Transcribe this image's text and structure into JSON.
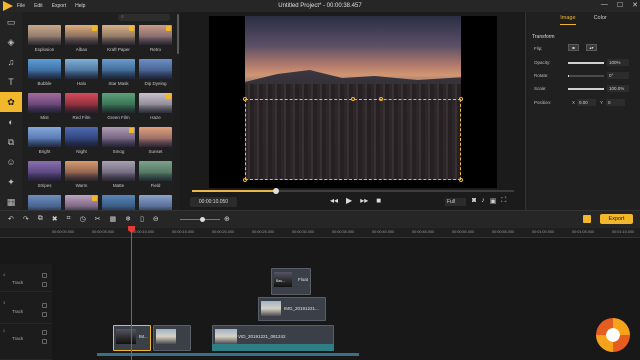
{
  "menubar": {
    "items": [
      "File",
      "Edit",
      "Export",
      "Help"
    ],
    "title": "Untitled Project* - 00:00:38.457",
    "controls": [
      "—",
      "☐",
      "✕"
    ]
  },
  "rail": {
    "icons": [
      "folder-icon",
      "layers-icon",
      "music-icon",
      "text-icon",
      "filter-icon",
      "overlay-icon",
      "transition-icon",
      "sticker-icon",
      "effects-icon",
      "element-icon"
    ],
    "active_index": 4
  },
  "filters": {
    "search_placeholder": "",
    "items": [
      {
        "label": "Explosion",
        "badge": false,
        "colors": [
          "#c8a98a",
          "#6b5b5a"
        ]
      },
      {
        "label": "Albao",
        "badge": true,
        "colors": [
          "#e0b07a",
          "#4a3e4a"
        ]
      },
      {
        "label": "Kraft Paper",
        "badge": true,
        "colors": [
          "#d7b486",
          "#5e5050"
        ]
      },
      {
        "label": "Retro",
        "badge": true,
        "colors": [
          "#c99c8a",
          "#594b5a"
        ]
      },
      {
        "label": "Bubble",
        "badge": false,
        "colors": [
          "#5d9ed6",
          "#2b4e7e"
        ]
      },
      {
        "label": "Halo",
        "badge": false,
        "colors": [
          "#7fb0d8",
          "#2c4f78"
        ]
      },
      {
        "label": "Star Mask",
        "badge": false,
        "colors": [
          "#6b9dcf",
          "#22446c"
        ]
      },
      {
        "label": "Dip Dyeing",
        "badge": false,
        "colors": [
          "#6c8fc4",
          "#2e4470"
        ]
      },
      {
        "label": "Mist",
        "badge": false,
        "colors": [
          "#a46aa0",
          "#3d2e58"
        ]
      },
      {
        "label": "Red Film",
        "badge": false,
        "colors": [
          "#d94a5a",
          "#5a1f2a"
        ]
      },
      {
        "label": "Green Film",
        "badge": false,
        "colors": [
          "#5ca27a",
          "#24503a"
        ]
      },
      {
        "label": "Haze",
        "badge": true,
        "colors": [
          "#c9c2cc",
          "#6a6670"
        ]
      },
      {
        "label": "Bright",
        "badge": false,
        "colors": [
          "#86a8dc",
          "#3a5a92"
        ]
      },
      {
        "label": "Night",
        "badge": false,
        "colors": [
          "#4e6ab3",
          "#1c2b58"
        ]
      },
      {
        "label": "Smog",
        "badge": true,
        "colors": [
          "#b09ab2",
          "#4a4060"
        ]
      },
      {
        "label": "Sunset",
        "badge": false,
        "colors": [
          "#e1a17a",
          "#6b4a5c"
        ]
      },
      {
        "label": "Stripes",
        "badge": false,
        "colors": [
          "#8a6fb0",
          "#3a2e60"
        ]
      },
      {
        "label": "Warm",
        "badge": false,
        "colors": [
          "#d89a6c",
          "#5c3e3a"
        ]
      },
      {
        "label": "Matte",
        "badge": false,
        "colors": [
          "#a8a0b4",
          "#504a5c"
        ]
      },
      {
        "label": "Field",
        "badge": false,
        "colors": [
          "#7ba38a",
          "#3a5a4a"
        ]
      },
      {
        "label": "",
        "badge": false,
        "colors": [
          "#6f8fc0",
          "#2b4068"
        ]
      },
      {
        "label": "",
        "badge": true,
        "colors": [
          "#c0a4c0",
          "#4a3a58"
        ]
      },
      {
        "label": "",
        "badge": false,
        "colors": [
          "#5a86b8",
          "#203a5c"
        ]
      },
      {
        "label": "",
        "badge": false,
        "colors": [
          "#8aa4cc",
          "#33476e"
        ]
      }
    ]
  },
  "preview": {
    "timecode": "00:00:10.050",
    "progress_fraction": 0.26,
    "quality": "Full"
  },
  "props": {
    "tabs": [
      "Image",
      "Color"
    ],
    "active_tab": "Image",
    "section": "Transform",
    "flip_label": "Flip:",
    "opacity_label": "Opacity:",
    "opacity_value": "100%",
    "opacity_fraction": 1.0,
    "rotate_label": "Rotate:",
    "rotate_value": "0°",
    "rotate_fraction": 0.0,
    "scale_label": "Scale:",
    "scale_value": "100.0%",
    "scale_fraction": 1.0,
    "position_label": "Position:",
    "pos_x_label": "X",
    "pos_x_value": "0.00",
    "pos_y_label": "Y",
    "pos_y_value": "0"
  },
  "timeline": {
    "export_label": "Export",
    "ruler": [
      "00:00:00.000",
      "00:00:05.000",
      "00:00:10.000",
      "00:00:15.000",
      "00:00:20.000",
      "00:00:25.000",
      "00:00:30.000",
      "00:00:35.000",
      "00:00:40.000",
      "00:00:45.000",
      "00:00:50.000",
      "00:00:55.000",
      "00:01:00.000",
      "00:01:05.000",
      "00:01:10.000"
    ],
    "tracks": [
      {
        "num": "4",
        "label": "Track"
      },
      {
        "num": "3",
        "label": "Track"
      },
      {
        "num": "2",
        "label": "Track"
      }
    ],
    "clips": {
      "float": "Float",
      "float_thumb": "Bas...",
      "img": "IMG_20191221...",
      "main_a": "IM...",
      "main_b": "",
      "vid": "VID_20191221_081242"
    }
  }
}
